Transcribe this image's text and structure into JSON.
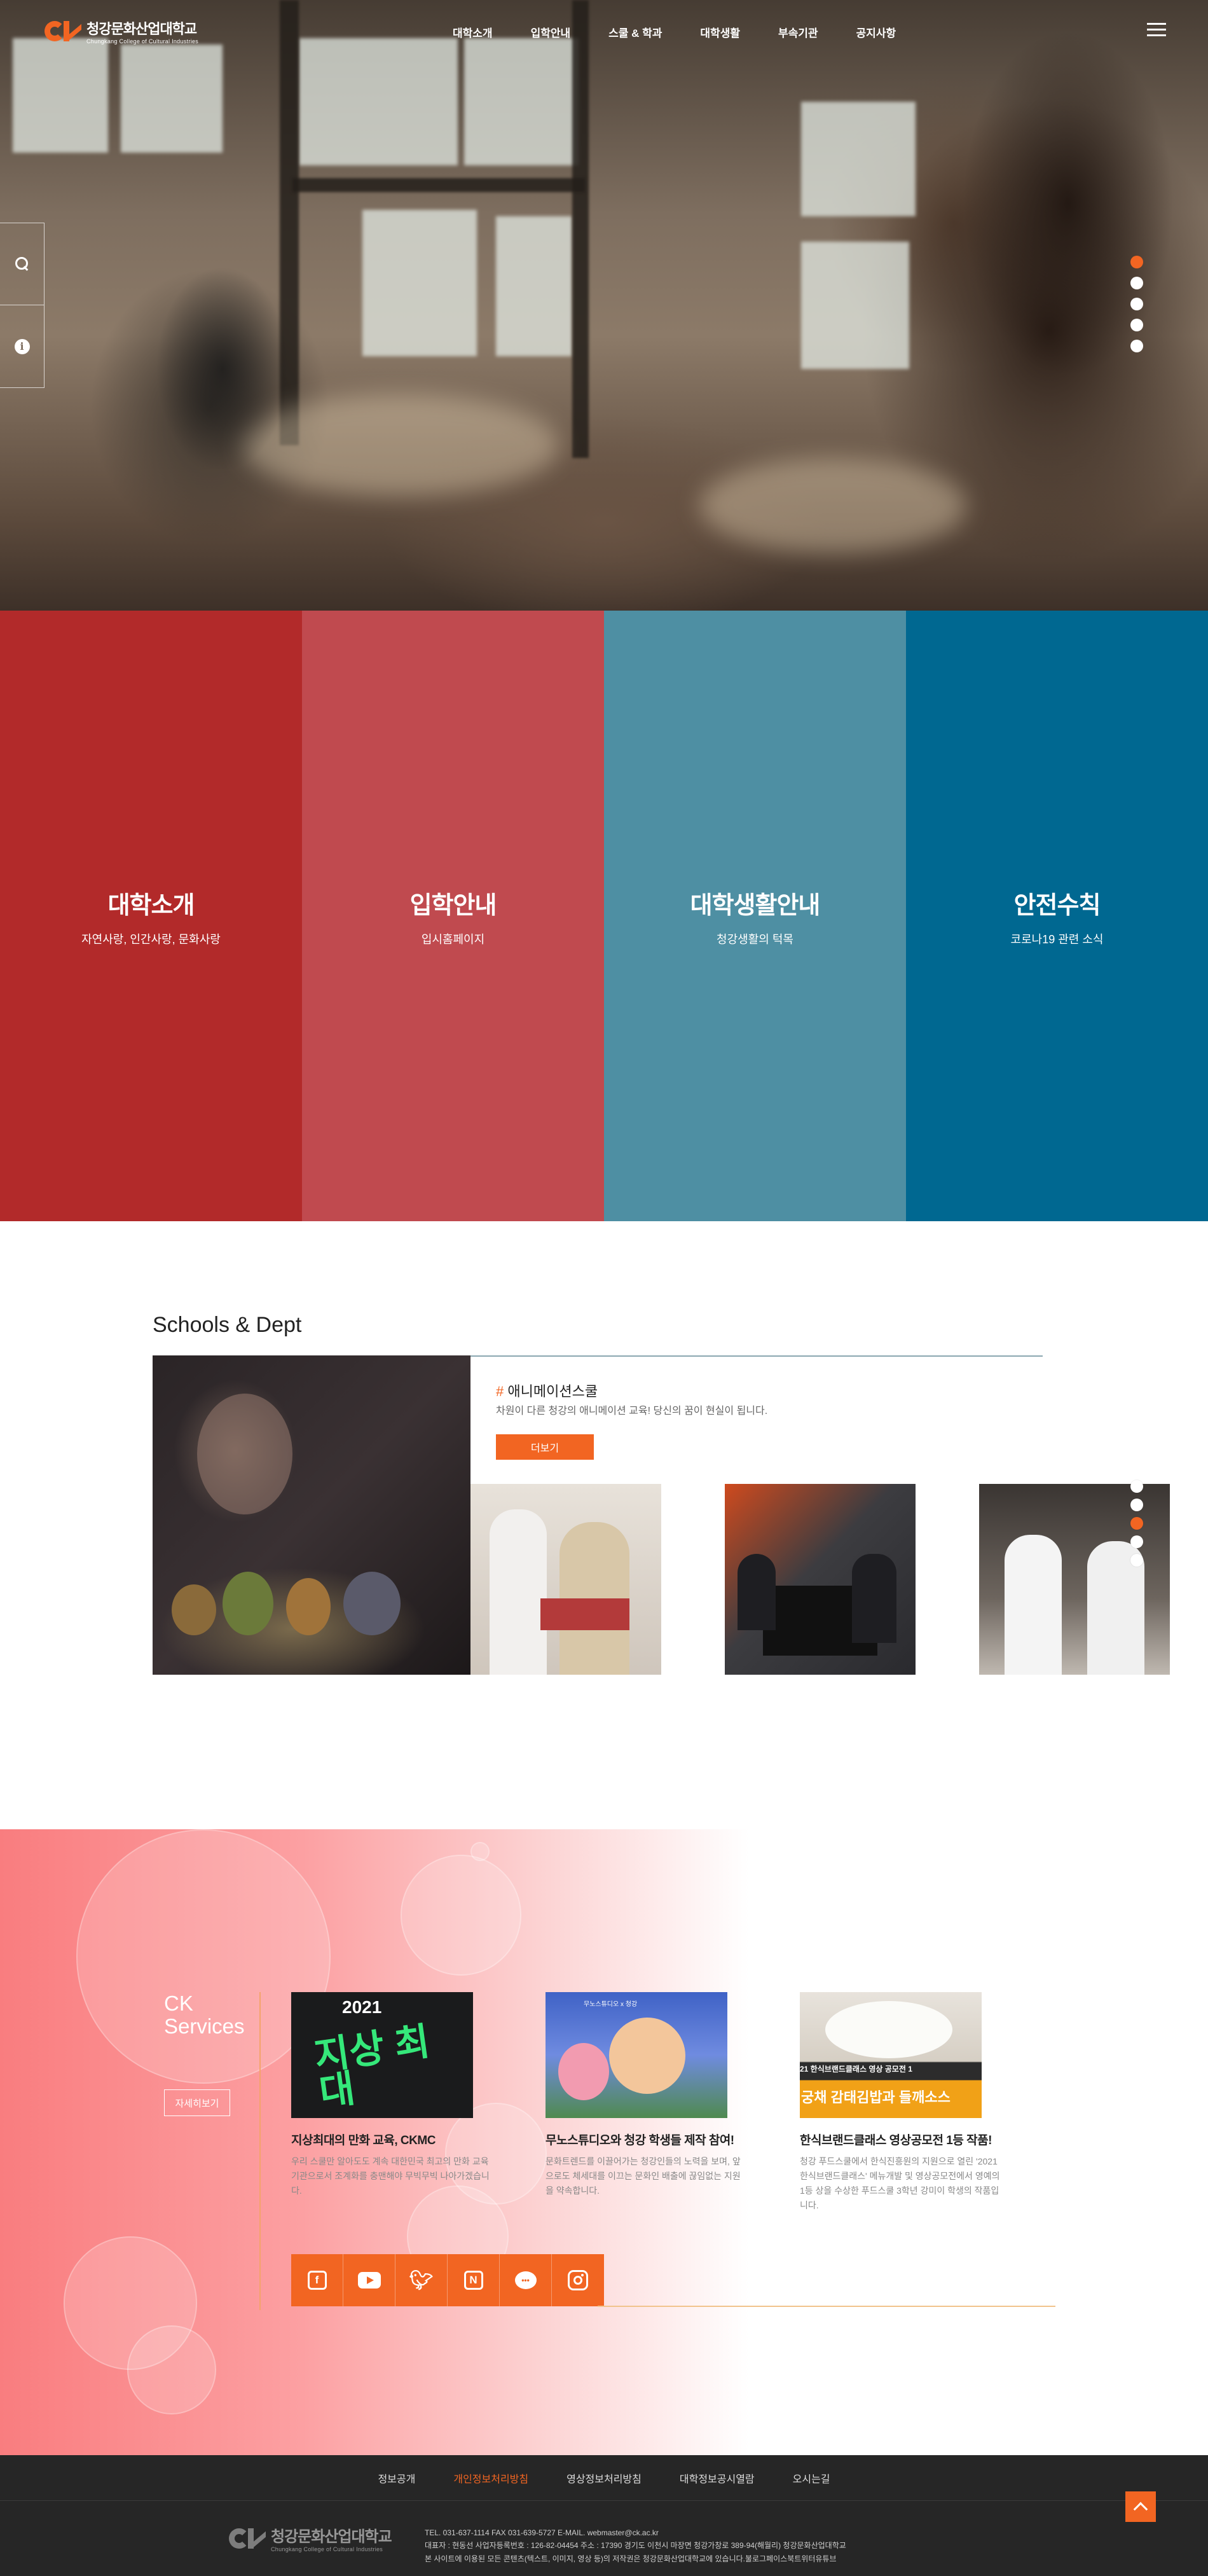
{
  "header": {
    "logo_kr": "청강문화산업대학교",
    "logo_en": "Chungkang College of Cultural Industries",
    "nav": [
      "대학소개",
      "입학안내",
      "스쿨 & 학과",
      "대학생활",
      "부속기관",
      "공지사항"
    ]
  },
  "quick_side": [
    "search-icon",
    "info-icon"
  ],
  "hero_slider": {
    "total": 5,
    "active": 1
  },
  "panels": [
    {
      "title": "대학소개",
      "subtitle": "자연사랑, 인간사랑, 문화사랑",
      "color": "#b22a2a"
    },
    {
      "title": "입학안내",
      "subtitle": "입시홈페이지",
      "color": "#c04a4f"
    },
    {
      "title": "대학생활안내",
      "subtitle": "청강생활의 턱목",
      "color": "#4e8fa3"
    },
    {
      "title": "안전수칙",
      "subtitle": "코로나19 관련 소식",
      "color": "#006891"
    }
  ],
  "schools": {
    "title": "Schools & Dept",
    "featured_hash": "#",
    "featured_name": "애니메이션스쿨",
    "featured_desc": "차원이 다른 청강의 애니메이션 교육! 당신의 꿈이 현실이 됩니다.",
    "more_label": "더보기",
    "slider": {
      "total": 5,
      "active": 3
    }
  },
  "services": {
    "title_line1": "CK",
    "title_line2": "Services",
    "detail_label": "자세히보기",
    "cards": [
      {
        "title": "지상최대의 만화 교육, CKMC",
        "desc": "우리 스쿨만 알아도도 계속 대한민국 최고의 만화 교육 기관으로서 조계화를 충맨해야 무빅무빅 나아가겠습니다.",
        "img_text_top": "2021",
        "img_text_main": "지상 최대"
      },
      {
        "title": "무노스튜디오와 청강 학생들 제작 참여!",
        "desc": "문화트렌드를 이끌어가는 청강인들의 노력을 보며, 앞으로도 체세대를 이끄는 문화인 배출에 끊임없는 지원을 약속합니다.",
        "img_text_top": "무노스튜디오 x 청강"
      },
      {
        "title": "한식브랜드클래스 영상공모전 1등 작품!",
        "desc": "청강 푸드스쿨에서 한식진흥원의 지원으로 열린 '2021 한식브랜드클래스' 메뉴개발 및 영상공모전에서 영예의 1등 상을 수상한 푸드스쿨 3학년 강미이 학생의 작품입니다.",
        "img_text_top": "21 한식브랜드클래스  영상 공모전 1",
        "img_text_main": "궁채 감태김밥과 들깨소스"
      }
    ],
    "sns": [
      "facebook-icon",
      "youtube-icon",
      "twitter-icon",
      "naver-icon",
      "kakaotalk-icon",
      "instagram-icon"
    ]
  },
  "footer": {
    "links": [
      "정보공개",
      "개인정보처리방침",
      "영상정보처리방침",
      "대학정보공시열람",
      "오시는길"
    ],
    "highlight_index": 1,
    "logo_kr": "청강문화산업대학교",
    "logo_en": "Chungkang College of Cultural Industries",
    "info_line1": "TEL. 031-637-1114 FAX 031-639-5727 E-MAIL. webmaster@ck.ac.kr",
    "info_line2": "대표자 : 현동선 사업자등록번호 : 126-82-04454 주소 : 17390 경기도 이천시 마장면 청강가창로 389-94(해월리) 청강문화산업대학교",
    "info_line3": "본 사이트에 이용된 모든 콘텐츠(텍스트, 이미지, 영상 등)의 저작권은 청강문화산업대학교에 있습니다.불로그페이스북트위터유튜브"
  }
}
